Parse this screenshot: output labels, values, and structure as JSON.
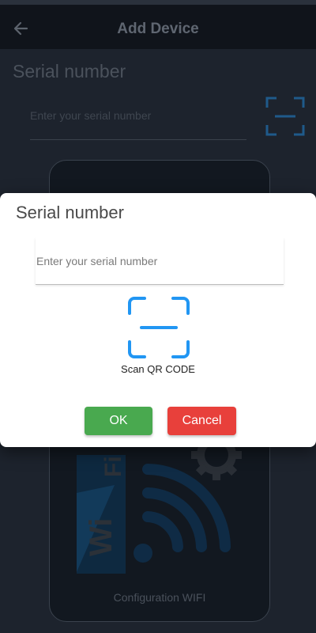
{
  "header": {
    "title": "Add Device",
    "back_icon": "arrow-left-icon"
  },
  "background": {
    "section_title": "Serial number",
    "serial_placeholder": "Enter your serial number",
    "config_label": "Configuration WIFI",
    "qr_icon": "qr-scan-icon",
    "wifi_icon": "wifi-icon",
    "gear_icon": "gear-icon"
  },
  "dialog": {
    "title": "Serial number",
    "serial_placeholder": "Enter your serial number",
    "serial_value": "",
    "scan_label": "Scan QR CODE",
    "ok_label": "OK",
    "cancel_label": "Cancel"
  },
  "colors": {
    "accent_blue": "#2196f3",
    "ok_green": "#49a94f",
    "cancel_red": "#e8403b"
  }
}
